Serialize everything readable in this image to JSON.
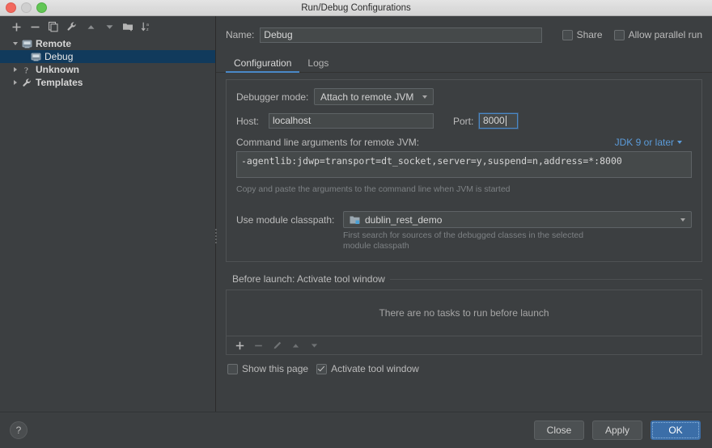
{
  "window": {
    "title": "Run/Debug Configurations",
    "controls": [
      "close-button",
      "minimize-button",
      "maximize-button"
    ]
  },
  "sidebar": {
    "toolbar": [
      {
        "name": "add-configuration-button",
        "icon": "plus-icon",
        "label": "+"
      },
      {
        "name": "remove-configuration-button",
        "icon": "minus-icon",
        "label": "−"
      },
      {
        "name": "copy-configuration-button",
        "icon": "copy-icon",
        "label": "Copy"
      },
      {
        "name": "edit-templates-button",
        "icon": "wrench-icon",
        "label": "Edit Templates"
      },
      {
        "name": "move-up-button",
        "icon": "arrow-up-icon",
        "label": "Move Up"
      },
      {
        "name": "move-down-button",
        "icon": "arrow-down-icon",
        "label": "Move Down"
      },
      {
        "name": "new-folder-button",
        "icon": "folder-add-icon",
        "label": "New Folder"
      },
      {
        "name": "sort-configurations-button",
        "icon": "sort-az-icon",
        "label": "Sort Configurations"
      }
    ],
    "tree": [
      {
        "label": "Remote",
        "icon": "remote-jvm-icon",
        "expanded": true,
        "selected": false,
        "level": 0
      },
      {
        "label": "Debug",
        "icon": "remote-jvm-icon",
        "expanded": null,
        "selected": true,
        "level": 1
      },
      {
        "label": "Unknown",
        "icon": "question-icon",
        "expanded": false,
        "selected": false,
        "level": 0
      },
      {
        "label": "Templates",
        "icon": "wrench-icon",
        "expanded": false,
        "selected": false,
        "level": 0
      }
    ]
  },
  "header": {
    "name_label": "Name:",
    "name_value": "Debug",
    "share_label": "Share",
    "share_checked": false,
    "parallel_label": "Allow parallel run",
    "parallel_checked": false
  },
  "tabs": [
    {
      "label": "Configuration",
      "active": true
    },
    {
      "label": "Logs",
      "active": false
    }
  ],
  "configuration": {
    "debugger_mode_label": "Debugger mode:",
    "debugger_mode_value": "Attach to remote JVM",
    "host_label": "Host:",
    "host_value": "localhost",
    "port_label": "Port:",
    "port_value": "8000",
    "cmd_label": "Command line arguments for remote JVM:",
    "jdk_selector": "JDK 9 or later",
    "cmd_value": "-agentlib:jdwp=transport=dt_socket,server=y,suspend=n,address=*:8000",
    "cmd_hint": "Copy and paste the arguments to the command line when JVM is started",
    "module_label": "Use module classpath:",
    "module_value": "dublin_rest_demo",
    "module_hint_line1": "First search for sources of the debugged classes in the selected",
    "module_hint_line2": "module classpath"
  },
  "before_launch": {
    "title": "Before launch: Activate tool window",
    "expanded": true,
    "empty_text": "There are no tasks to run before launch",
    "toolbar": [
      {
        "name": "add-task-button",
        "icon": "plus-icon",
        "enabled": true
      },
      {
        "name": "remove-task-button",
        "icon": "minus-icon",
        "enabled": false
      },
      {
        "name": "edit-task-button",
        "icon": "pencil-icon",
        "enabled": false
      },
      {
        "name": "task-move-up-button",
        "icon": "arrow-up-icon",
        "enabled": false
      },
      {
        "name": "task-move-down-button",
        "icon": "arrow-down-icon",
        "enabled": false
      }
    ],
    "show_page_label": "Show this page",
    "show_page_checked": false,
    "activate_window_label": "Activate tool window",
    "activate_window_checked": true
  },
  "footer": {
    "help_label": "?",
    "close_label": "Close",
    "apply_label": "Apply",
    "ok_label": "OK"
  },
  "colors": {
    "accent": "#4a88c7",
    "selection": "#113a5c",
    "link": "#5b9bd9",
    "primary_button": "#3b6ea8",
    "background": "#3c3f41",
    "field_background": "#45494a"
  }
}
